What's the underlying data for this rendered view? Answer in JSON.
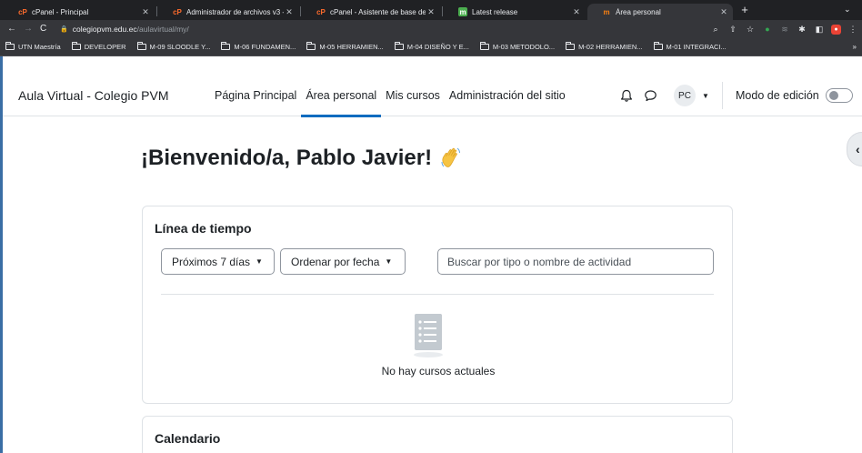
{
  "browser": {
    "tabs": [
      {
        "title": "cPanel - Principal",
        "favicon": "cpanel-icon",
        "active": false
      },
      {
        "title": "Administrador de archivos v3 - ",
        "favicon": "cpanel-icon",
        "active": false
      },
      {
        "title": "cPanel - Asistente de base de ",
        "favicon": "cpanel-icon",
        "active": false
      },
      {
        "title": "Latest release",
        "favicon": "moodle-icon",
        "active": false
      },
      {
        "title": "Área personal",
        "favicon": "moodle-icon",
        "active": true
      }
    ],
    "url_host": "colegiopvm.edu.ec",
    "url_path": "/aulavirtual/my/",
    "bookmarks": [
      "UTN Maestría",
      "DEVELOPER",
      "M-09 SLOODLE Y...",
      "M-06 FUNDAMEN...",
      "M-05 HERRAMIEN...",
      "M-04 DISEÑO Y E...",
      "M-03 METODOLO...",
      "M-02 HERRAMIEN...",
      "M-01 INTEGRACI..."
    ],
    "more_bookmarks": "»"
  },
  "site": {
    "brand": "Aula Virtual - Colegio PVM",
    "nav": [
      {
        "label": "Página Principal",
        "active": false
      },
      {
        "label": "Área personal",
        "active": true
      },
      {
        "label": "Mis cursos",
        "active": false
      },
      {
        "label": "Administración del sitio",
        "active": false
      }
    ],
    "user_initials": "PC",
    "edit_mode_label": "Modo de edición",
    "edit_mode_on": false
  },
  "main": {
    "welcome": "¡Bienvenido/a, Pablo Javier!",
    "timeline": {
      "title": "Línea de tiempo",
      "filter_days": "Próximos 7 días",
      "sort": "Ordenar por fecha",
      "search_placeholder": "Buscar por tipo o nombre de actividad",
      "empty_text": "No hay cursos actuales"
    },
    "calendar": {
      "title": "Calendario"
    }
  },
  "colors": {
    "accent": "#0f6cbf",
    "chrome_dark": "#202124",
    "chrome_toolbar": "#35363a"
  }
}
